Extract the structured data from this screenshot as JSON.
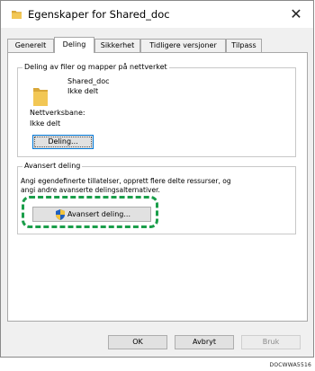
{
  "window": {
    "title": "Egenskaper for Shared_doc",
    "close_label": "✕"
  },
  "tabs": [
    {
      "label": "Generelt",
      "active": false
    },
    {
      "label": "Deling",
      "active": true
    },
    {
      "label": "Sikkerhet",
      "active": false
    },
    {
      "label": "Tidligere versjoner",
      "active": false
    },
    {
      "label": "Tilpass",
      "active": false
    }
  ],
  "sharing_group": {
    "legend": "Deling av filer og mapper på nettverket",
    "folder_name": "Shared_doc",
    "folder_status": "Ikke delt",
    "network_path_label": "Nettverksbane:",
    "network_path_value": "Ikke delt",
    "share_button": "Deling..."
  },
  "advanced_group": {
    "legend": "Avansert deling",
    "description_line1": "Angi egendefinerte tillatelser, opprett flere delte ressurser, og",
    "description_line2": "angi andre avanserte delingsalternativer.",
    "advanced_button": "Avansert deling..."
  },
  "footer": {
    "ok": "OK",
    "cancel": "Avbryt",
    "apply": "Bruk"
  },
  "doc_code": "DOCWWA5516",
  "colors": {
    "highlight_dash": "#1a9e4a",
    "folder_yellow": "#e8b84a",
    "focus_border": "#0078d7"
  },
  "icons": [
    "folder-icon",
    "close-icon",
    "shield-icon"
  ]
}
